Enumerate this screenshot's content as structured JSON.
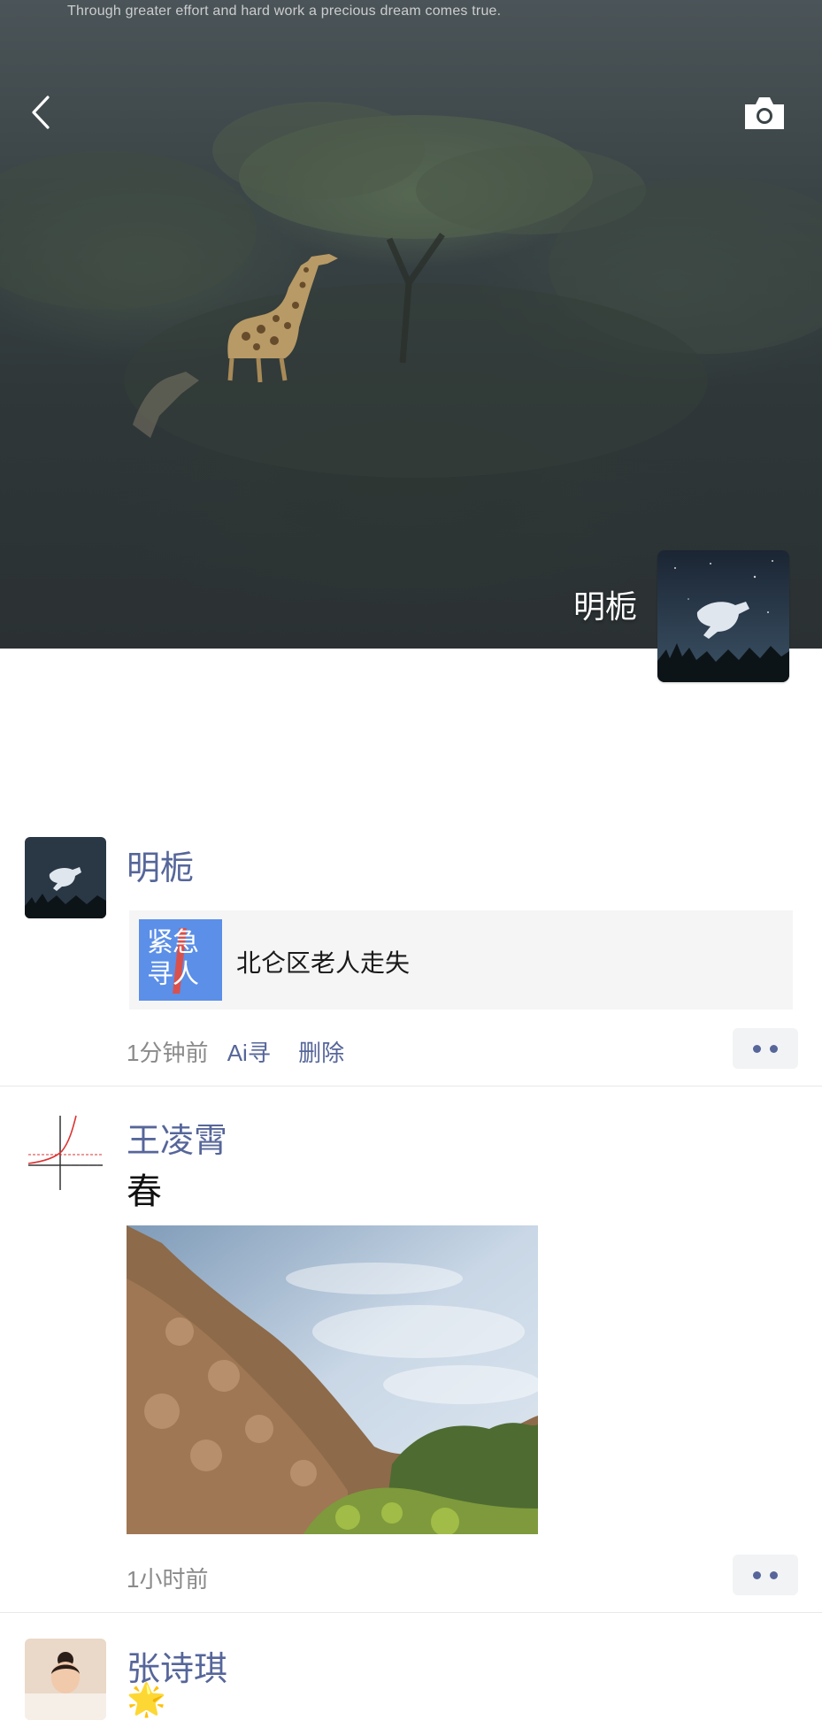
{
  "cover": {
    "motto": "Through greater effort and hard work a precious dream comes true.",
    "owner_name": "明栀"
  },
  "posts": [
    {
      "author": "明栀",
      "share": {
        "thumb_text_line1": "紧急",
        "thumb_text_line2": "寻人",
        "title": "北仑区老人走失"
      },
      "time": "1分钟前",
      "source": "Ai寻",
      "delete_label": "删除"
    },
    {
      "author": "王凌霄",
      "text": "春",
      "time": "1小时前"
    },
    {
      "author": "张诗琪",
      "text": "🌟"
    }
  ],
  "colors": {
    "link": "#56669a",
    "meta": "#8a8a8a",
    "share_bg": "#f5f5f5",
    "thumb_bg": "#5b8fe8"
  }
}
